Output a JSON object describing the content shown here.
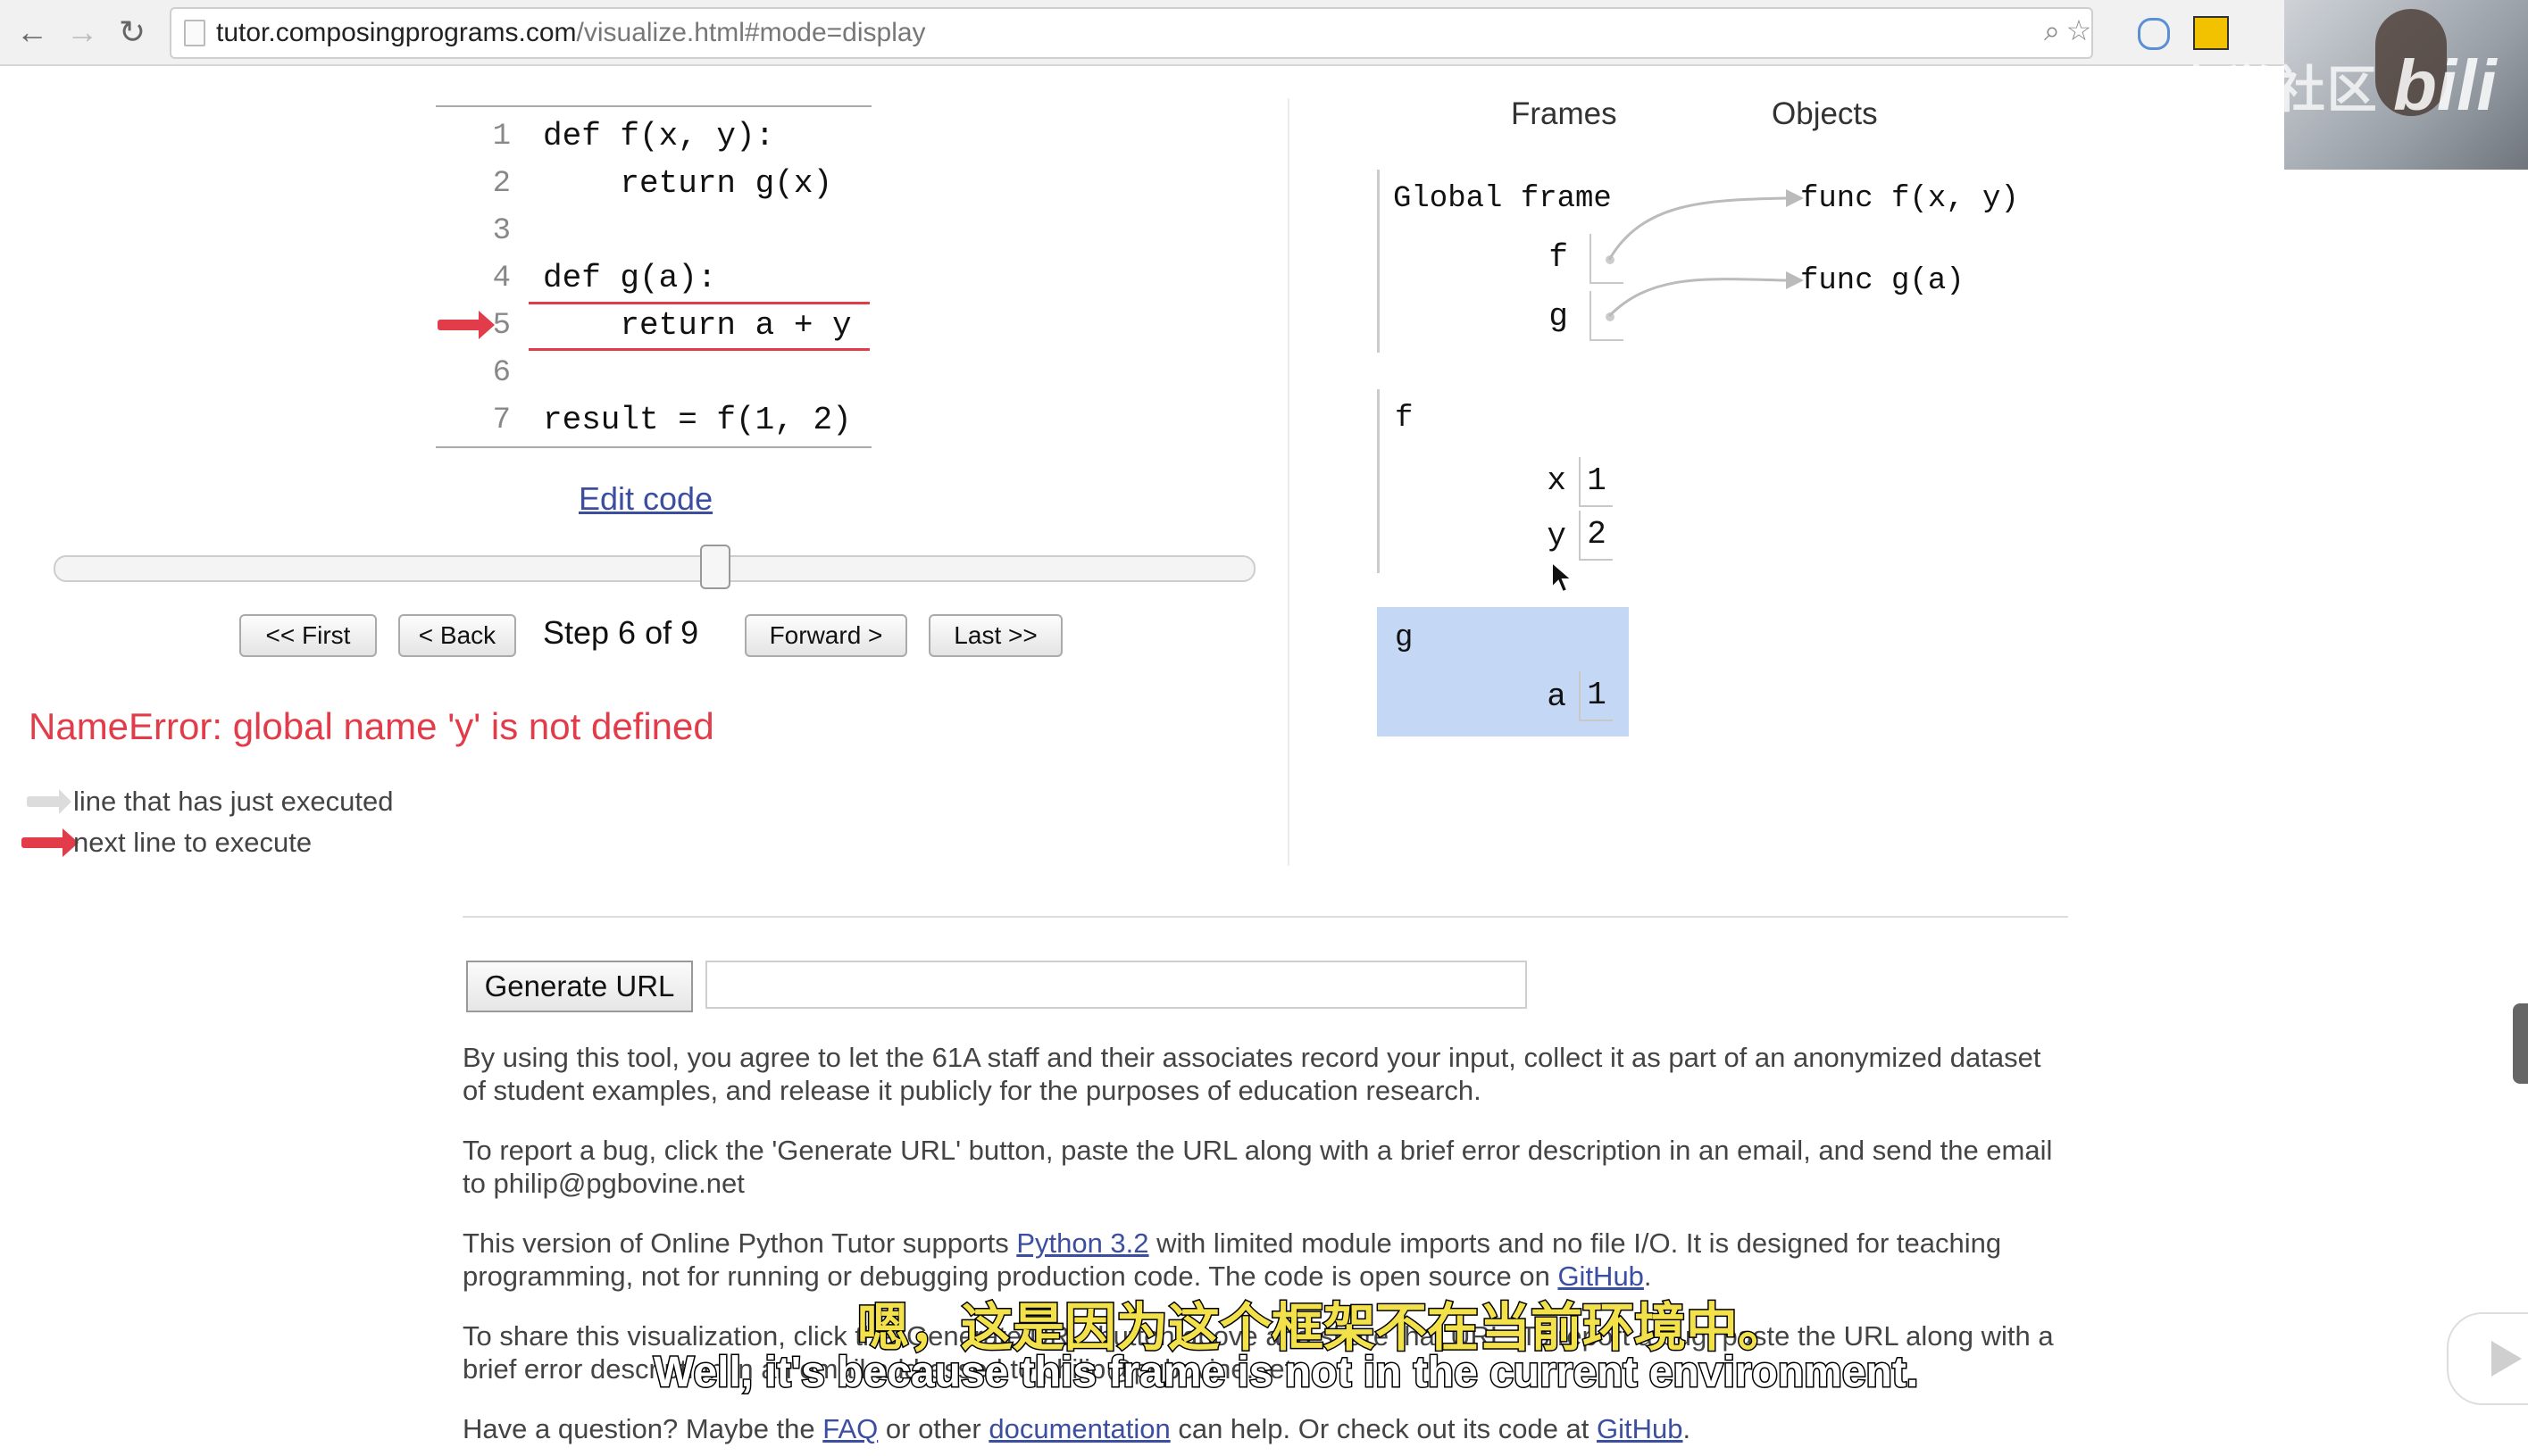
{
  "browser": {
    "url_host": "tutor.composingprograms.com",
    "url_path": "/visualize.html#mode=display",
    "back_icon": "←",
    "forward_icon": "→",
    "reload_icon": "↻",
    "zoom_icon": "⌕",
    "star_icon": "☆"
  },
  "overlay": {
    "watermark": "CS自学社区",
    "logo": "bili"
  },
  "code": {
    "lines": [
      {
        "no": "1",
        "text": "def f(x, y):"
      },
      {
        "no": "2",
        "text": "    return g(x)"
      },
      {
        "no": "3",
        "text": ""
      },
      {
        "no": "4",
        "text": "def g(a):"
      },
      {
        "no": "5",
        "text": "    return a + y"
      },
      {
        "no": "6",
        "text": ""
      },
      {
        "no": "7",
        "text": "result = f(1, 2)"
      }
    ],
    "edit_link": "Edit code"
  },
  "controls": {
    "first": "<< First",
    "back": "< Back",
    "step_label": "Step 6 of 9",
    "forward": "Forward >",
    "last": "Last >>",
    "current_step": 6,
    "total_steps": 9
  },
  "error": "NameError: global name 'y' is not defined",
  "legend": {
    "executed": "line that has just executed",
    "next": "next line to execute"
  },
  "viz": {
    "frames_header": "Frames",
    "objects_header": "Objects",
    "global_frame": {
      "title": "Global frame",
      "vars": [
        {
          "name": "f"
        },
        {
          "name": "g"
        }
      ]
    },
    "f_frame": {
      "title": "f",
      "vars": [
        {
          "name": "x",
          "value": "1"
        },
        {
          "name": "y",
          "value": "2"
        }
      ]
    },
    "g_frame": {
      "title": "g",
      "vars": [
        {
          "name": "a",
          "value": "1"
        }
      ]
    },
    "objects": [
      "func f(x, y)",
      "func g(a)"
    ]
  },
  "footer": {
    "generate_button": "Generate URL",
    "p1": "By using this tool, you agree to let the 61A staff and their associates record your input, collect it as part of an anonymized dataset of student examples, and release it publicly for the purposes of education research.",
    "p2": "To report a bug, click the 'Generate URL' button, paste the URL along with a brief error description in an email, and send the email to philip@pgbovine.net",
    "p3_a": "This version of Online Python Tutor supports ",
    "p3_link1": "Python 3.2",
    "p3_b": " with limited module imports and no file I/O. It is designed for teaching programming, not for running or debugging production code. The code is open source on ",
    "p3_link2": "GitHub",
    "p3_c": ".",
    "p4": "To share this visualization, click the 'Generate URL' button above and share that URL. To report a bug, paste the URL along with a brief error description in an email addressed to philip@pgbovine.net",
    "p5_a": "Have a question? Maybe the ",
    "p5_link1": "FAQ",
    "p5_b": " or other ",
    "p5_link2": "documentation",
    "p5_c": " can help. Or check out its code at ",
    "p5_link3": "GitHub",
    "p5_d": "."
  },
  "subtitles": {
    "zh": "嗯，这是因为这个框架不在当前环境中。",
    "en": "Well, it's because this frame is not in the current environment."
  }
}
